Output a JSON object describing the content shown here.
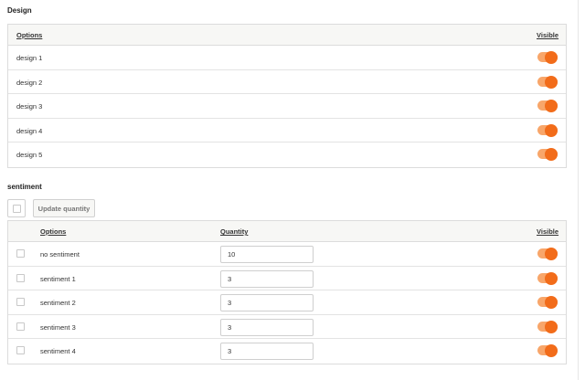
{
  "design": {
    "title": "Design",
    "columns": {
      "options": "Options",
      "visible": "Visible"
    },
    "rows": [
      {
        "label": "design 1",
        "visible": true
      },
      {
        "label": "design 2",
        "visible": true
      },
      {
        "label": "design 3",
        "visible": true
      },
      {
        "label": "design 4",
        "visible": true
      },
      {
        "label": "design 5",
        "visible": true
      }
    ]
  },
  "sentiment": {
    "title": "sentiment",
    "update_button": "Update quantity",
    "columns": {
      "options": "Options",
      "quantity": "Quantity",
      "visible": "Visible"
    },
    "rows": [
      {
        "label": "no sentiment",
        "quantity": "10",
        "visible": true
      },
      {
        "label": "sentiment 1",
        "quantity": "3",
        "visible": true
      },
      {
        "label": "sentiment 2",
        "quantity": "3",
        "visible": true
      },
      {
        "label": "sentiment 3",
        "quantity": "3",
        "visible": true
      },
      {
        "label": "sentiment 4",
        "quantity": "3",
        "visible": true
      }
    ]
  },
  "colors": {
    "toggle_on": "#f26c1a",
    "toggle_track": "#f8a66a",
    "header_bg": "#f7f7f5"
  }
}
